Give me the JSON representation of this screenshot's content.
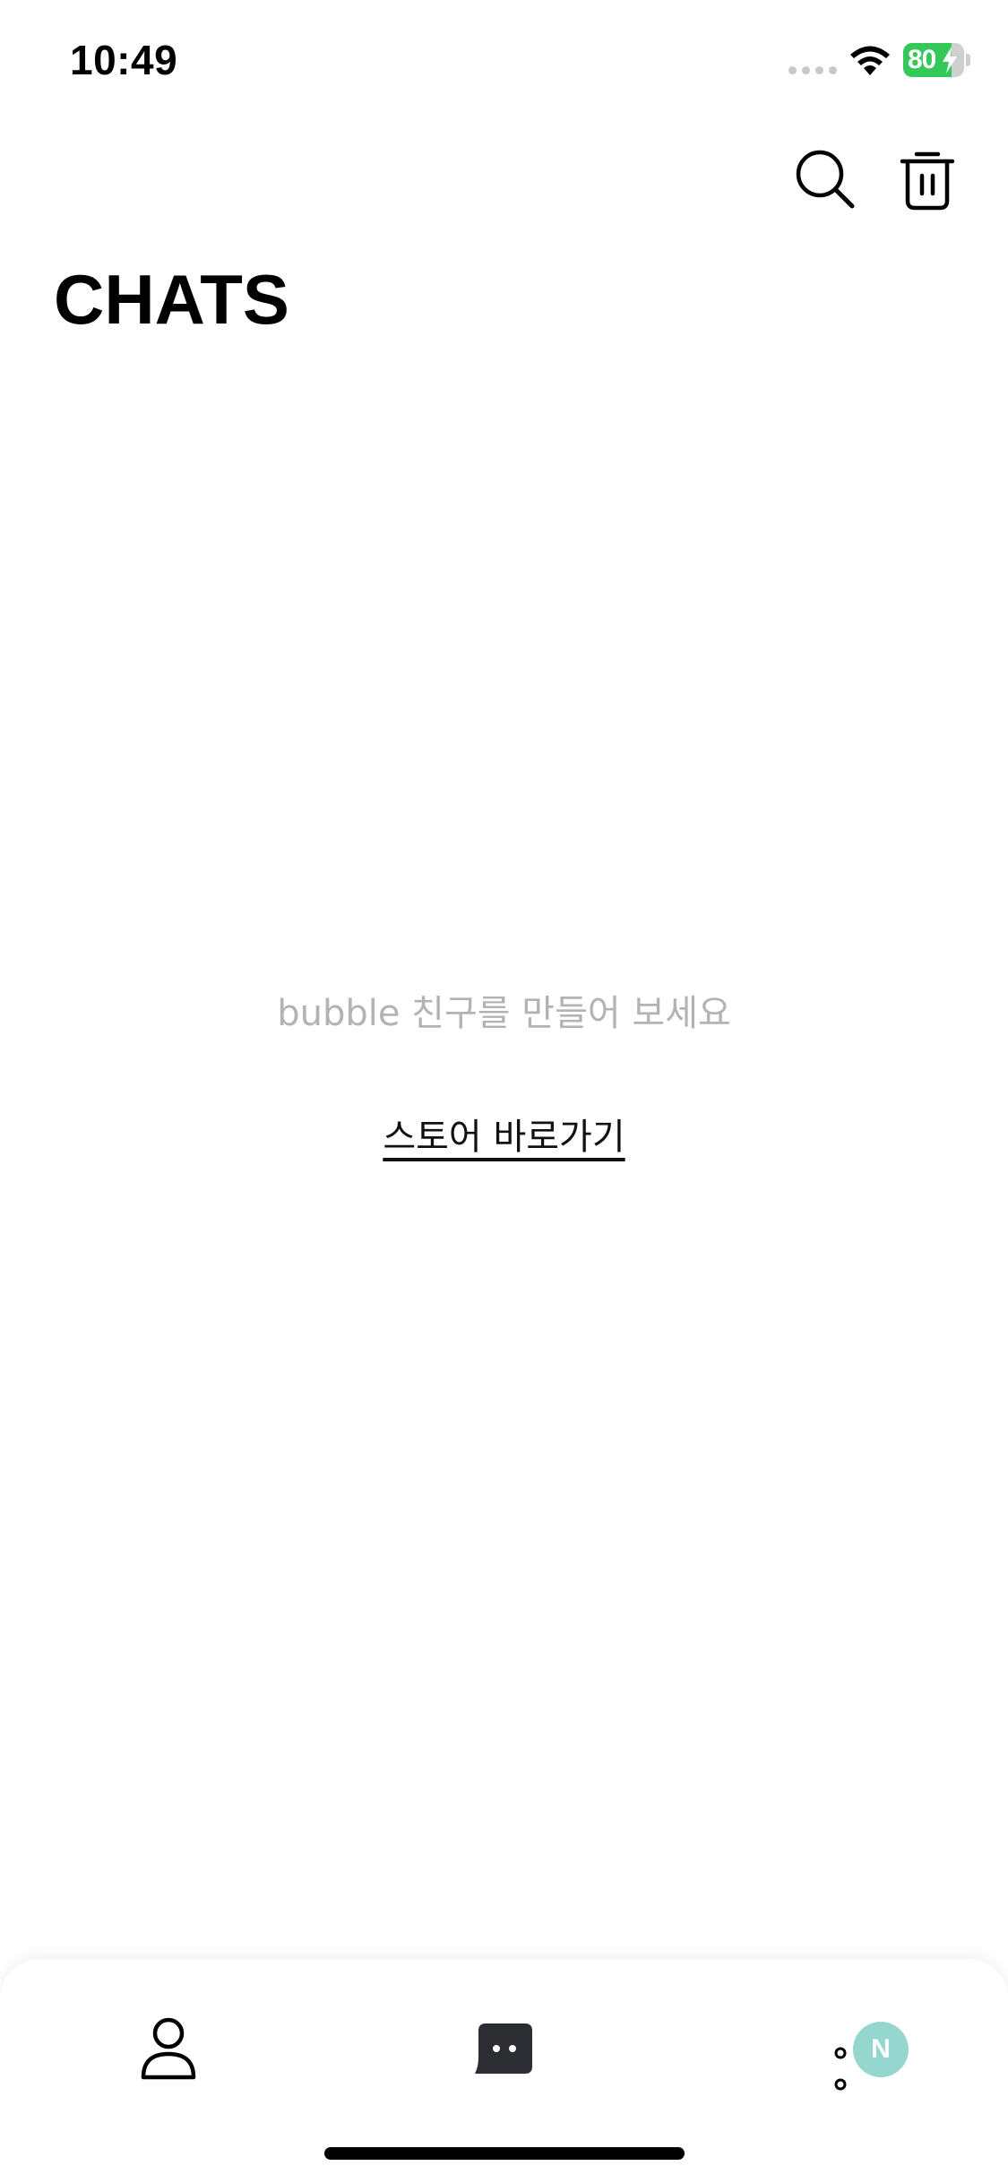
{
  "status_bar": {
    "time": "10:49",
    "battery_level": "80",
    "battery_charging": true
  },
  "header": {
    "title": "CHATS",
    "actions": [
      {
        "icon": "search-icon"
      },
      {
        "icon": "trash-icon"
      }
    ]
  },
  "empty_state": {
    "message": "bubble 친구를 만들어 보세요",
    "link_label": "스토어 바로가기"
  },
  "tab_bar": {
    "tabs": [
      {
        "icon": "person-icon",
        "selected": false
      },
      {
        "icon": "chat-bubble-icon",
        "selected": true
      },
      {
        "icon": "more-dots-icon",
        "selected": false,
        "badge": "N"
      }
    ]
  },
  "colors": {
    "accent_green_battery": "#34c759",
    "badge": "#95d6cf",
    "muted_text": "#b3b3b3",
    "chat_tab": "#2c2d33"
  }
}
